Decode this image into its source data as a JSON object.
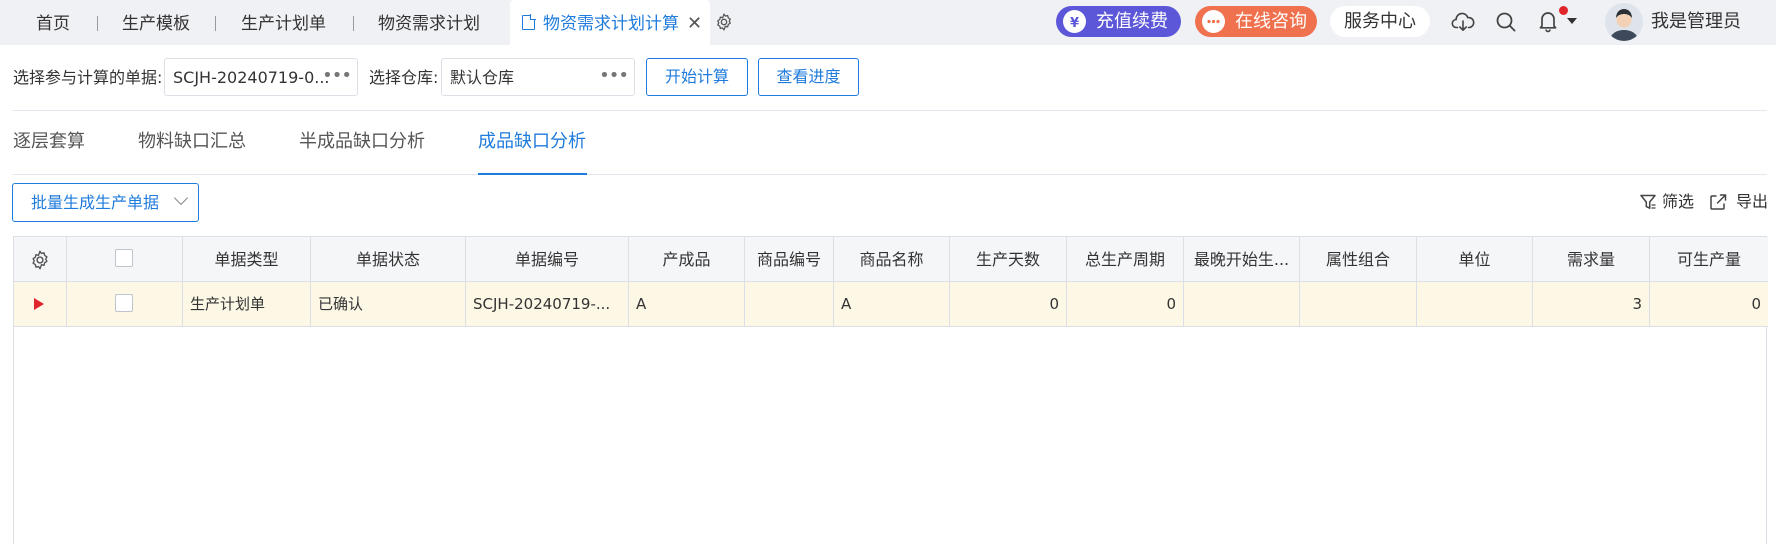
{
  "tabs": [
    {
      "label": "首页"
    },
    {
      "label": "生产模板"
    },
    {
      "label": "生产计划单"
    },
    {
      "label": "物资需求计划"
    },
    {
      "label": "物资需求计划计算",
      "active": true
    }
  ],
  "header": {
    "recharge_label": "充值续费",
    "consult_label": "在线咨询",
    "service_label": "服务中心",
    "user_name": "我是管理员",
    "recharge_color": "#5b57d8",
    "consult_color": "#f0714e",
    "notification_dot_color": "#e0262b"
  },
  "filters": {
    "doc_label": "选择参与计算的单据:",
    "doc_value": "SCJH-20240719-0...",
    "warehouse_label": "选择仓库:",
    "warehouse_value": "默认仓库",
    "start_button": "开始计算",
    "progress_button": "查看进度"
  },
  "subtabs": [
    {
      "label": "逐层套算"
    },
    {
      "label": "物料缺口汇总"
    },
    {
      "label": "半成品缺口分析"
    },
    {
      "label": "成品缺口分析",
      "active": true
    }
  ],
  "toolbar": {
    "batch_label": "批量生成生产单据",
    "filter_label": "筛选",
    "export_label": "导出"
  },
  "grid": {
    "columns": [
      "单据类型",
      "单据状态",
      "单据编号",
      "产成品",
      "商品编号",
      "商品名称",
      "生产天数",
      "总生产周期",
      "最晚开始生...",
      "属性组合",
      "单位",
      "需求量",
      "可生产量"
    ],
    "rows": [
      {
        "doc_type": "生产计划单",
        "doc_status": "已确认",
        "doc_no": "SCJH-20240719-...",
        "product": "A",
        "item_code": "",
        "item_name": "A",
        "prod_days": "0",
        "total_cycle": "0",
        "latest_start": "",
        "attr_combo": "",
        "unit": "",
        "demand_qty": "3",
        "producible_qty": "0"
      }
    ]
  },
  "accent_color": "#1f7bdc"
}
